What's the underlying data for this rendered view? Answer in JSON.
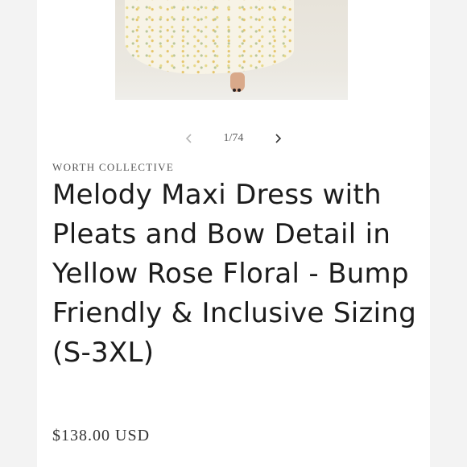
{
  "gallery": {
    "counter": "1/74",
    "prev_icon": "chevron-left-icon",
    "next_icon": "chevron-right-icon"
  },
  "product": {
    "vendor": "WORTH COLLECTIVE",
    "title": "Melody Maxi Dress with Pleats and Bow Detail in Yellow Rose Floral - Bump Friendly & Inclusive Sizing (S-3XL)",
    "price": "$138.00 USD"
  }
}
